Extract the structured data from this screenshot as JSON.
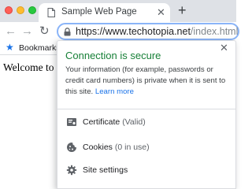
{
  "window": {
    "controls": [
      "close",
      "minimize",
      "maximize"
    ]
  },
  "tab": {
    "title": "Sample Web Page",
    "close_glyph": "✕",
    "favicon": "document-icon"
  },
  "new_tab_glyph": "+",
  "toolbar": {
    "back_glyph": "←",
    "forward_glyph": "→",
    "reload_glyph": "↻",
    "url_host": "https://www.techotopia.net",
    "url_path": "/index.html"
  },
  "bookmarks_bar": {
    "label": "Bookmarks"
  },
  "page": {
    "heading": "Welcome to My"
  },
  "security_popup": {
    "close_glyph": "✕",
    "title": "Connection is secure",
    "description": "Your information (for example, passwords or credit card numbers) is private when it is sent to this site.",
    "learn_more": "Learn more",
    "items": [
      {
        "label": "Certificate",
        "detail": "(Valid)",
        "icon": "certificate-icon"
      },
      {
        "label": "Cookies",
        "detail": "(0 in use)",
        "icon": "cookie-icon"
      },
      {
        "label": "Site settings",
        "detail": "",
        "icon": "gear-icon"
      }
    ]
  },
  "colors": {
    "secure_green": "#188038",
    "link_blue": "#1a73e8",
    "tab_strip": "#dee1e6",
    "focus_ring": "#8ab4f8"
  }
}
